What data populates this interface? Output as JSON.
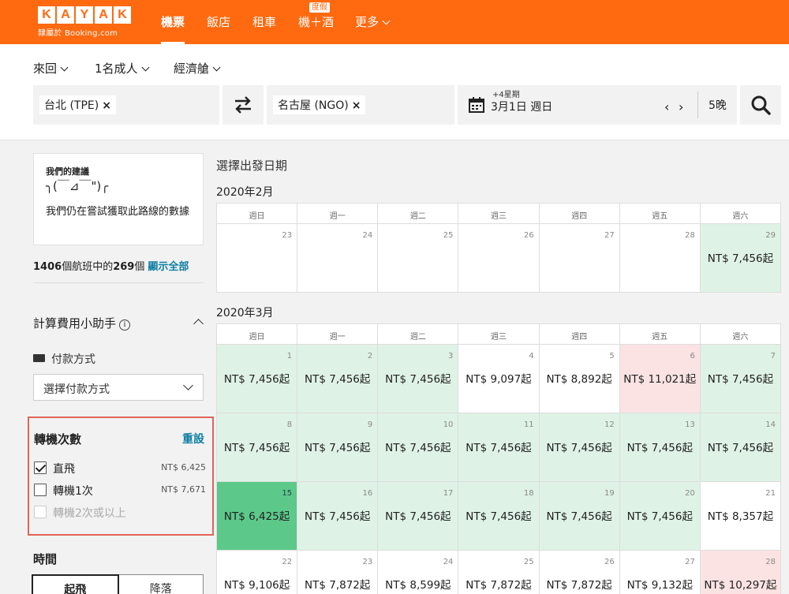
{
  "nav": {
    "logo_letters": [
      "K",
      "A",
      "Y",
      "A",
      "K"
    ],
    "logo_sub": "隸屬於 Booking.com",
    "items": [
      {
        "label": "機票",
        "active": true
      },
      {
        "label": "飯店"
      },
      {
        "label": "租車"
      },
      {
        "label": "機＋酒",
        "badge": "度假"
      },
      {
        "label": "更多"
      }
    ]
  },
  "search": {
    "trip_type": "來回",
    "travelers": "1名成人",
    "cabin": "經濟艙",
    "origin": "台北 (TPE)",
    "destination": "名古屋 (NGO)",
    "date_hint": "+4星期",
    "date": "3月1日 週日",
    "nights": "5晚",
    "remove_glyph": "×"
  },
  "sidebar": {
    "suggestion": {
      "title": "我們的建議",
      "face": "╮(￣⊿￣\")╭",
      "text": "我們仍在嘗試獲取此路線的數據"
    },
    "flight_count": {
      "total": "1406",
      "middle": "個航班中的",
      "shown": "269",
      "suffix": "個",
      "show_all": "顯示全部"
    },
    "fee_helper": {
      "title": "計算費用小助手",
      "info_glyph": "i",
      "payment_label": "付款方式",
      "payment_placeholder": "選擇付款方式"
    },
    "stops": {
      "title": "轉機次數",
      "reset": "重設",
      "options": [
        {
          "label": "直飛",
          "price": "NT$ 6,425",
          "checked": true
        },
        {
          "label": "轉機1次",
          "price": "NT$ 7,671",
          "checked": false
        },
        {
          "label": "轉機2次或以上",
          "price": "",
          "checked": false,
          "disabled": true
        }
      ]
    },
    "time": {
      "title": "時間",
      "tabs": [
        "起飛",
        "降落"
      ]
    }
  },
  "calendar": {
    "heading": "選擇出發日期",
    "weekdays": [
      "週日",
      "週一",
      "週二",
      "週三",
      "週四",
      "週五",
      "週六"
    ],
    "months": [
      {
        "title": "2020年2月",
        "rows": [
          [
            {
              "day": "23",
              "price": "",
              "tone": "none"
            },
            {
              "day": "24",
              "price": "",
              "tone": "none"
            },
            {
              "day": "25",
              "price": "",
              "tone": "none"
            },
            {
              "day": "26",
              "price": "",
              "tone": "none"
            },
            {
              "day": "27",
              "price": "",
              "tone": "none"
            },
            {
              "day": "28",
              "price": "",
              "tone": "none"
            },
            {
              "day": "29",
              "price": "NT$ 7,456起",
              "tone": "green"
            }
          ]
        ]
      },
      {
        "title": "2020年3月",
        "rows": [
          [
            {
              "day": "1",
              "price": "NT$ 7,456起",
              "tone": "green"
            },
            {
              "day": "2",
              "price": "NT$ 7,456起",
              "tone": "green"
            },
            {
              "day": "3",
              "price": "NT$ 7,456起",
              "tone": "green"
            },
            {
              "day": "4",
              "price": "NT$ 9,097起",
              "tone": "none"
            },
            {
              "day": "5",
              "price": "NT$ 8,892起",
              "tone": "none"
            },
            {
              "day": "6",
              "price": "NT$ 11,021起",
              "tone": "pink"
            },
            {
              "day": "7",
              "price": "NT$ 7,456起",
              "tone": "green"
            }
          ],
          [
            {
              "day": "8",
              "price": "NT$ 7,456起",
              "tone": "green"
            },
            {
              "day": "9",
              "price": "NT$ 7,456起",
              "tone": "green"
            },
            {
              "day": "10",
              "price": "NT$ 7,456起",
              "tone": "green"
            },
            {
              "day": "11",
              "price": "NT$ 7,456起",
              "tone": "green"
            },
            {
              "day": "12",
              "price": "NT$ 7,456起",
              "tone": "green"
            },
            {
              "day": "13",
              "price": "NT$ 7,456起",
              "tone": "green"
            },
            {
              "day": "14",
              "price": "NT$ 7,456起",
              "tone": "green"
            }
          ],
          [
            {
              "day": "15",
              "price": "NT$ 6,425起",
              "tone": "best"
            },
            {
              "day": "16",
              "price": "NT$ 7,456起",
              "tone": "green"
            },
            {
              "day": "17",
              "price": "NT$ 7,456起",
              "tone": "green"
            },
            {
              "day": "18",
              "price": "NT$ 7,456起",
              "tone": "green"
            },
            {
              "day": "19",
              "price": "NT$ 7,456起",
              "tone": "green"
            },
            {
              "day": "20",
              "price": "NT$ 7,456起",
              "tone": "green"
            },
            {
              "day": "21",
              "price": "NT$ 8,357起",
              "tone": "none"
            }
          ],
          [
            {
              "day": "22",
              "price": "NT$ 9,106起",
              "tone": "none"
            },
            {
              "day": "23",
              "price": "NT$ 7,872起",
              "tone": "none"
            },
            {
              "day": "24",
              "price": "NT$ 8,599起",
              "tone": "none"
            },
            {
              "day": "25",
              "price": "NT$ 7,872起",
              "tone": "none"
            },
            {
              "day": "26",
              "price": "NT$ 7,872起",
              "tone": "none"
            },
            {
              "day": "27",
              "price": "NT$ 9,132起",
              "tone": "none"
            },
            {
              "day": "28",
              "price": "NT$ 10,297起",
              "tone": "pink"
            }
          ]
        ]
      }
    ]
  },
  "colors": {
    "brand": "#ff690f",
    "link": "#0d7ea3",
    "cheap": "#dff2e6",
    "cheapest": "#5cc98a",
    "expensive": "#fbe3e3",
    "highlight_border": "#e06457"
  }
}
